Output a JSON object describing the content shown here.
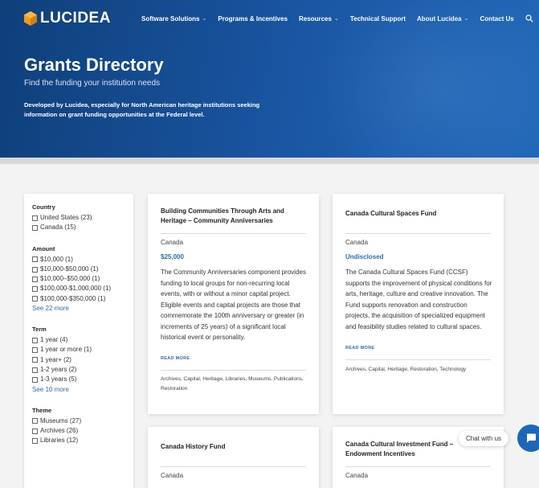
{
  "brand": {
    "name": "LUCIDEA",
    "logo_color": "#f39b1b"
  },
  "nav": {
    "items": [
      {
        "label": "Software Solutions",
        "has_dropdown": true
      },
      {
        "label": "Programs & Incentives",
        "has_dropdown": false
      },
      {
        "label": "Resources",
        "has_dropdown": true
      },
      {
        "label": "Technical Support",
        "has_dropdown": false
      },
      {
        "label": "About Lucidea",
        "has_dropdown": true
      },
      {
        "label": "Contact Us",
        "has_dropdown": false
      }
    ],
    "caret": "⌄",
    "search_icon": "search-icon"
  },
  "hero": {
    "title": "Grants Directory",
    "subtitle": "Find the funding your institution needs",
    "description": "Developed by Lucidea, especially for North American heritage institutions seeking information on grant funding opportunities at the Federal level."
  },
  "filters": [
    {
      "title": "Country",
      "options": [
        "United States (23)",
        "Canada (15)"
      ],
      "see_more": ""
    },
    {
      "title": "Amount",
      "options": [
        "$10,000 (1)",
        "$10,000-$50,000 (1)",
        "$10,000–$50,000 (1)",
        "$100,000-$1,000,000 (1)",
        "$100,000-$350,000 (1)"
      ],
      "see_more": "See 22 more"
    },
    {
      "title": "Term",
      "options": [
        "1 year (4)",
        "1 year or more (1)",
        "1 year+ (2)",
        "1-2 years (2)",
        "1-3 years (5)"
      ],
      "see_more": "See 10 more"
    },
    {
      "title": "Theme",
      "options": [
        "Museums (27)",
        "Archives (26)",
        "Libraries (12)"
      ],
      "see_more": ""
    }
  ],
  "cards": [
    {
      "title": "Building Communities Through Arts and Heritage – Community Anniversaries",
      "country": "Canada",
      "amount": "$25,000",
      "description": "The Community Anniversaries component provides funding to local groups for non-recurring local events, with or without a minor capital project. Eligible events and capital projects are those that commemorate the 100th anniversary or greater (in increments of 25 years) of a significant local historical event or personality.",
      "read_more": "READ MORE",
      "tags": "Archives, Capital, Heritage, Libraries, Museums, Publications, Restoration"
    },
    {
      "title": "Canada Cultural Spaces Fund",
      "country": "Canada",
      "amount": "Undisclosed",
      "description": "The Canada Cultural Spaces Fund (CCSF) supports the improvement of physical conditions for arts, heritage, culture and creative innovation. The Fund supports renovation and construction projects, the acquisition of specialized equipment and feasibility studies related to cultural spaces.",
      "read_more": "READ MORE",
      "tags": "Archives, Capital, Heritage, Restoration, Technology"
    },
    {
      "title": "Canada History Fund",
      "country": "Canada"
    },
    {
      "title": "Canada Cultural Investment Fund – Endowment Incentives",
      "country": "Canada"
    }
  ],
  "chat": {
    "label": "Chat with us",
    "accent": "#1e66b8"
  }
}
